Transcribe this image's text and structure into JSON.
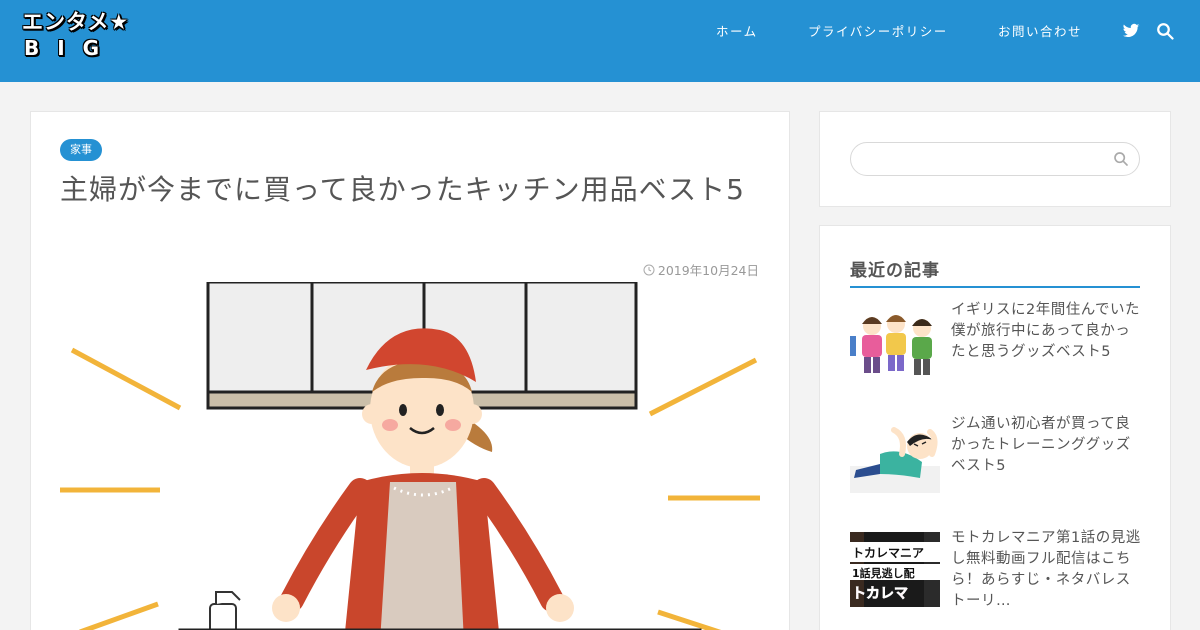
{
  "site": {
    "logo_line1": "エンタメ★",
    "logo_line2": "BIG"
  },
  "nav": {
    "items": [
      {
        "label": "ホーム"
      },
      {
        "label": "プライバシーポリシー"
      },
      {
        "label": "お問い合わせ"
      }
    ],
    "icons": [
      "twitter-icon",
      "search-icon"
    ]
  },
  "post": {
    "category": "家事",
    "title": "主婦が今までに買って良かったキッチン用品ベスト5",
    "date": "2019年10月24日"
  },
  "sidebar": {
    "search": {
      "placeholder": ""
    },
    "recent": {
      "heading": "最近の記事",
      "items": [
        {
          "title": "イギリスに2年間住んでいた僕が旅行中にあって良かったと思うグッズベスト5"
        },
        {
          "title": "ジム通い初心者が買って良かったトレーニンググッズベスト5"
        },
        {
          "title": "モトカレマニア第1話の見逃し無料動画フル配信はこちら！あらすじ・ネタバレストーリ…",
          "thumb_text_1": "トカレマニア",
          "thumb_text_2": "1話見逃し配",
          "thumb_text_3": "トカレマ"
        }
      ]
    }
  },
  "colors": {
    "header": "#2591d3",
    "accent": "#2591d3",
    "background": "#f3f3f3"
  }
}
